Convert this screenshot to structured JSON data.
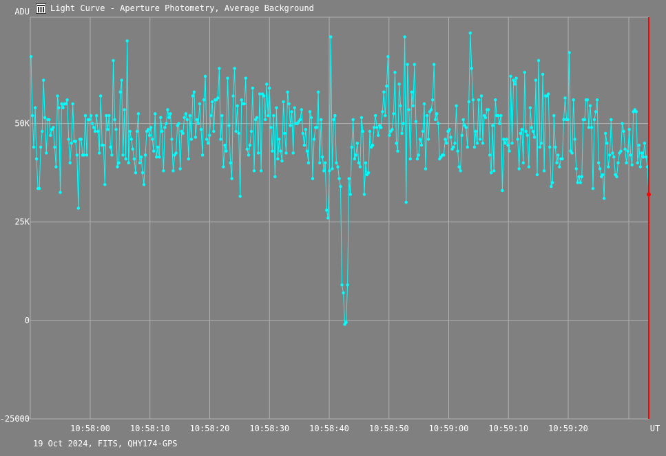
{
  "window": {
    "title": "Light Curve - Aperture Photometry, Average Background",
    "icon": "light-curve-app-icon"
  },
  "footer": {
    "caption": "19 Oct 2024, FITS, QHY174-GPS"
  },
  "colors": {
    "background": "#808080",
    "grid": "#b0b0b0",
    "series": "#00ffff",
    "cursor": "#ff0000",
    "text": "#ffffff"
  },
  "chart_data": {
    "type": "line",
    "title": "Light Curve - Aperture Photometry, Average Background",
    "xlabel": "UT",
    "ylabel": "ADU",
    "ylim": [
      -25000,
      77000
    ],
    "x_ticks": [
      "10:58:00",
      "10:58:10",
      "10:58:20",
      "10:58:30",
      "10:58:40",
      "10:58:50",
      "10:59:00",
      "10:59:10",
      "10:59:20"
    ],
    "y_ticks": [
      "-25000",
      "0",
      "25K",
      "50K",
      "ADU"
    ],
    "grid": true,
    "legend": "none",
    "cursor": {
      "frame": 400,
      "value": 32000
    },
    "series": [
      {
        "values": [
          67000,
          52000,
          44000,
          54000,
          41000,
          33500,
          33500,
          44000,
          48000,
          61000,
          51500,
          42500,
          51000,
          51000,
          47000,
          48500,
          49000,
          44000,
          39000,
          57000,
          54000,
          32500,
          55000,
          54000,
          55000,
          55000,
          56000,
          46000,
          40000,
          45000,
          55000,
          45500,
          45500,
          42000,
          28500,
          46000,
          46000,
          42000,
          42000,
          52000,
          42000,
          51000,
          51000,
          52000,
          50000,
          49000,
          48000,
          52000,
          48000,
          42500,
          57000,
          44500,
          44500,
          34500,
          52000,
          48500,
          52000,
          44000,
          42000,
          66000,
          51000,
          48500,
          39000,
          40000,
          58000,
          61000,
          42000,
          53500,
          41000,
          71000,
          40000,
          48000,
          46000,
          43500,
          41000,
          37500,
          48000,
          52500,
          40000,
          41500,
          37500,
          34500,
          42000,
          48000,
          48500,
          47000,
          49000,
          46000,
          43000,
          52500,
          41500,
          44000,
          41500,
          51500,
          48000,
          38000,
          49000,
          50000,
          53500,
          51500,
          52500,
          46000,
          38000,
          42000,
          42500,
          49500,
          50000,
          38500,
          48000,
          47500,
          51500,
          52500,
          51000,
          41000,
          52000,
          46000,
          57000,
          58000,
          46500,
          51000,
          50000,
          55000,
          48500,
          42000,
          56000,
          62000,
          46000,
          45000,
          47000,
          52000,
          55500,
          48000,
          56000,
          56000,
          56500,
          64000,
          46000,
          52000,
          39000,
          44500,
          43000,
          61500,
          49500,
          40000,
          36000,
          57000,
          64000,
          48000,
          54500,
          47500,
          31500,
          56000,
          55000,
          55000,
          61500,
          43500,
          42000,
          44500,
          48000,
          59000,
          38000,
          51000,
          51500,
          42500,
          57500,
          38000,
          57500,
          57000,
          51000,
          60000,
          52000,
          59000,
          49000,
          43000,
          52000,
          36500,
          54000,
          41000,
          46000,
          43000,
          40500,
          55500,
          47500,
          42500,
          58000,
          55000,
          49500,
          53000,
          42500,
          54000,
          50000,
          50000,
          50500,
          51000,
          53500,
          47500,
          44500,
          48500,
          43000,
          40000,
          53000,
          51500,
          36000,
          46000,
          49000,
          49000,
          58000,
          40000,
          51000,
          41500,
          38000,
          40000,
          28000,
          26000,
          38000,
          72000,
          38500,
          51000,
          52000,
          40000,
          39000,
          36000,
          34000,
          9000,
          7000,
          -1000,
          -500,
          9000,
          36000,
          32000,
          44000,
          51000,
          41000,
          42000,
          45000,
          40000,
          39000,
          51500,
          48000,
          32000,
          40000,
          37000,
          37500,
          48000,
          44000,
          44500,
          49000,
          52000,
          49000,
          47000,
          49500,
          49000,
          53000,
          58000,
          52000,
          59500,
          67000,
          47000,
          48000,
          48500,
          52500,
          63000,
          45000,
          43000,
          60000,
          54500,
          47500,
          50000,
          72000,
          30000,
          65000,
          53500,
          41000,
          58000,
          54500,
          65000,
          50500,
          41000,
          42000,
          46000,
          44500,
          48000,
          55000,
          38500,
          52000,
          46000,
          53000,
          53500,
          56000,
          65000,
          51000,
          52500,
          50000,
          41000,
          41500,
          42000,
          42000,
          46000,
          45000,
          48000,
          48500,
          46500,
          43500,
          44000,
          45000,
          54500,
          43000,
          39000,
          38000,
          47000,
          51000,
          49500,
          49000,
          44000,
          55500,
          73000,
          64000,
          56000,
          44000,
          48000,
          45000,
          56000,
          46000,
          57000,
          45000,
          52000,
          51500,
          53500,
          53500,
          42000,
          37500,
          49500,
          38000,
          56000,
          52000,
          52000,
          50000,
          52000,
          33000,
          46000,
          45000,
          46000,
          44500,
          43000,
          62000,
          45000,
          61000,
          60000,
          61500,
          46000,
          38500,
          47500,
          48500,
          40000,
          63000,
          48000,
          47000,
          39000,
          54000,
          49000,
          48000,
          46500,
          61000,
          37000,
          66000,
          44000,
          45000,
          62500,
          38000,
          57000,
          57000,
          57500,
          44000,
          34000,
          35000,
          52000,
          44000,
          40000,
          42000,
          39000,
          41000,
          41000,
          51000,
          56500,
          51000,
          51000,
          68000,
          43000,
          42500,
          56000,
          46000,
          38500,
          35000,
          36500,
          35000,
          36500,
          51000,
          51000,
          56000,
          56000,
          49000,
          54500,
          49000,
          33500,
          51000,
          53000,
          56000,
          40000,
          38500,
          36500,
          37000,
          31000,
          47500,
          45000,
          39000,
          42000,
          51000,
          42500,
          41500,
          37000,
          36500,
          40000,
          42500,
          43000,
          50000,
          48000,
          43500,
          40000,
          43000,
          48500,
          42000,
          39500,
          53000,
          53500,
          53000,
          40000,
          44500,
          39000,
          42500,
          41500,
          45000,
          41500,
          39000,
          32000
        ]
      }
    ]
  }
}
